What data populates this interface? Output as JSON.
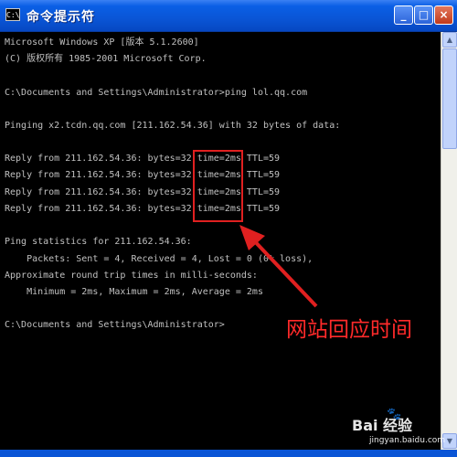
{
  "window": {
    "icon_text": "C:\\",
    "title": "命令提示符",
    "buttons": {
      "minimize": "_",
      "maximize": "□",
      "close": "×"
    }
  },
  "console": {
    "lines": [
      "Microsoft Windows XP [版本 5.1.2600]",
      "(C) 版权所有 1985-2001 Microsoft Corp.",
      "",
      "C:\\Documents and Settings\\Administrator>ping lol.qq.com",
      "",
      "Pinging x2.tcdn.qq.com [211.162.54.36] with 32 bytes of data:",
      "",
      "Reply from 211.162.54.36: bytes=32 time=2ms TTL=59",
      "Reply from 211.162.54.36: bytes=32 time=2ms TTL=59",
      "Reply from 211.162.54.36: bytes=32 time=2ms TTL=59",
      "Reply from 211.162.54.36: bytes=32 time=2ms TTL=59",
      "",
      "Ping statistics for 211.162.54.36:",
      "    Packets: Sent = 4, Received = 4, Lost = 0 (0% loss),",
      "Approximate round trip times in milli-seconds:",
      "    Minimum = 2ms, Maximum = 2ms, Average = 2ms",
      "",
      "C:\\Documents and Settings\\Administrator>"
    ]
  },
  "annotation": {
    "text": "网站回应时间",
    "color": "#ff2a2a"
  },
  "watermark": {
    "brand": "Bai 经验",
    "url": "jingyan.baidu.com"
  },
  "colors": {
    "titlebar": "#0a55d6",
    "console_bg": "#000000",
    "console_text": "#c0c0c0",
    "highlight": "#e02020"
  },
  "icons": {
    "app": "cmd-icon",
    "scroll_up": "arrow-up-icon",
    "scroll_down": "arrow-down-icon",
    "arrow": "red-arrow-icon",
    "paw": "baidu-paw-icon"
  }
}
